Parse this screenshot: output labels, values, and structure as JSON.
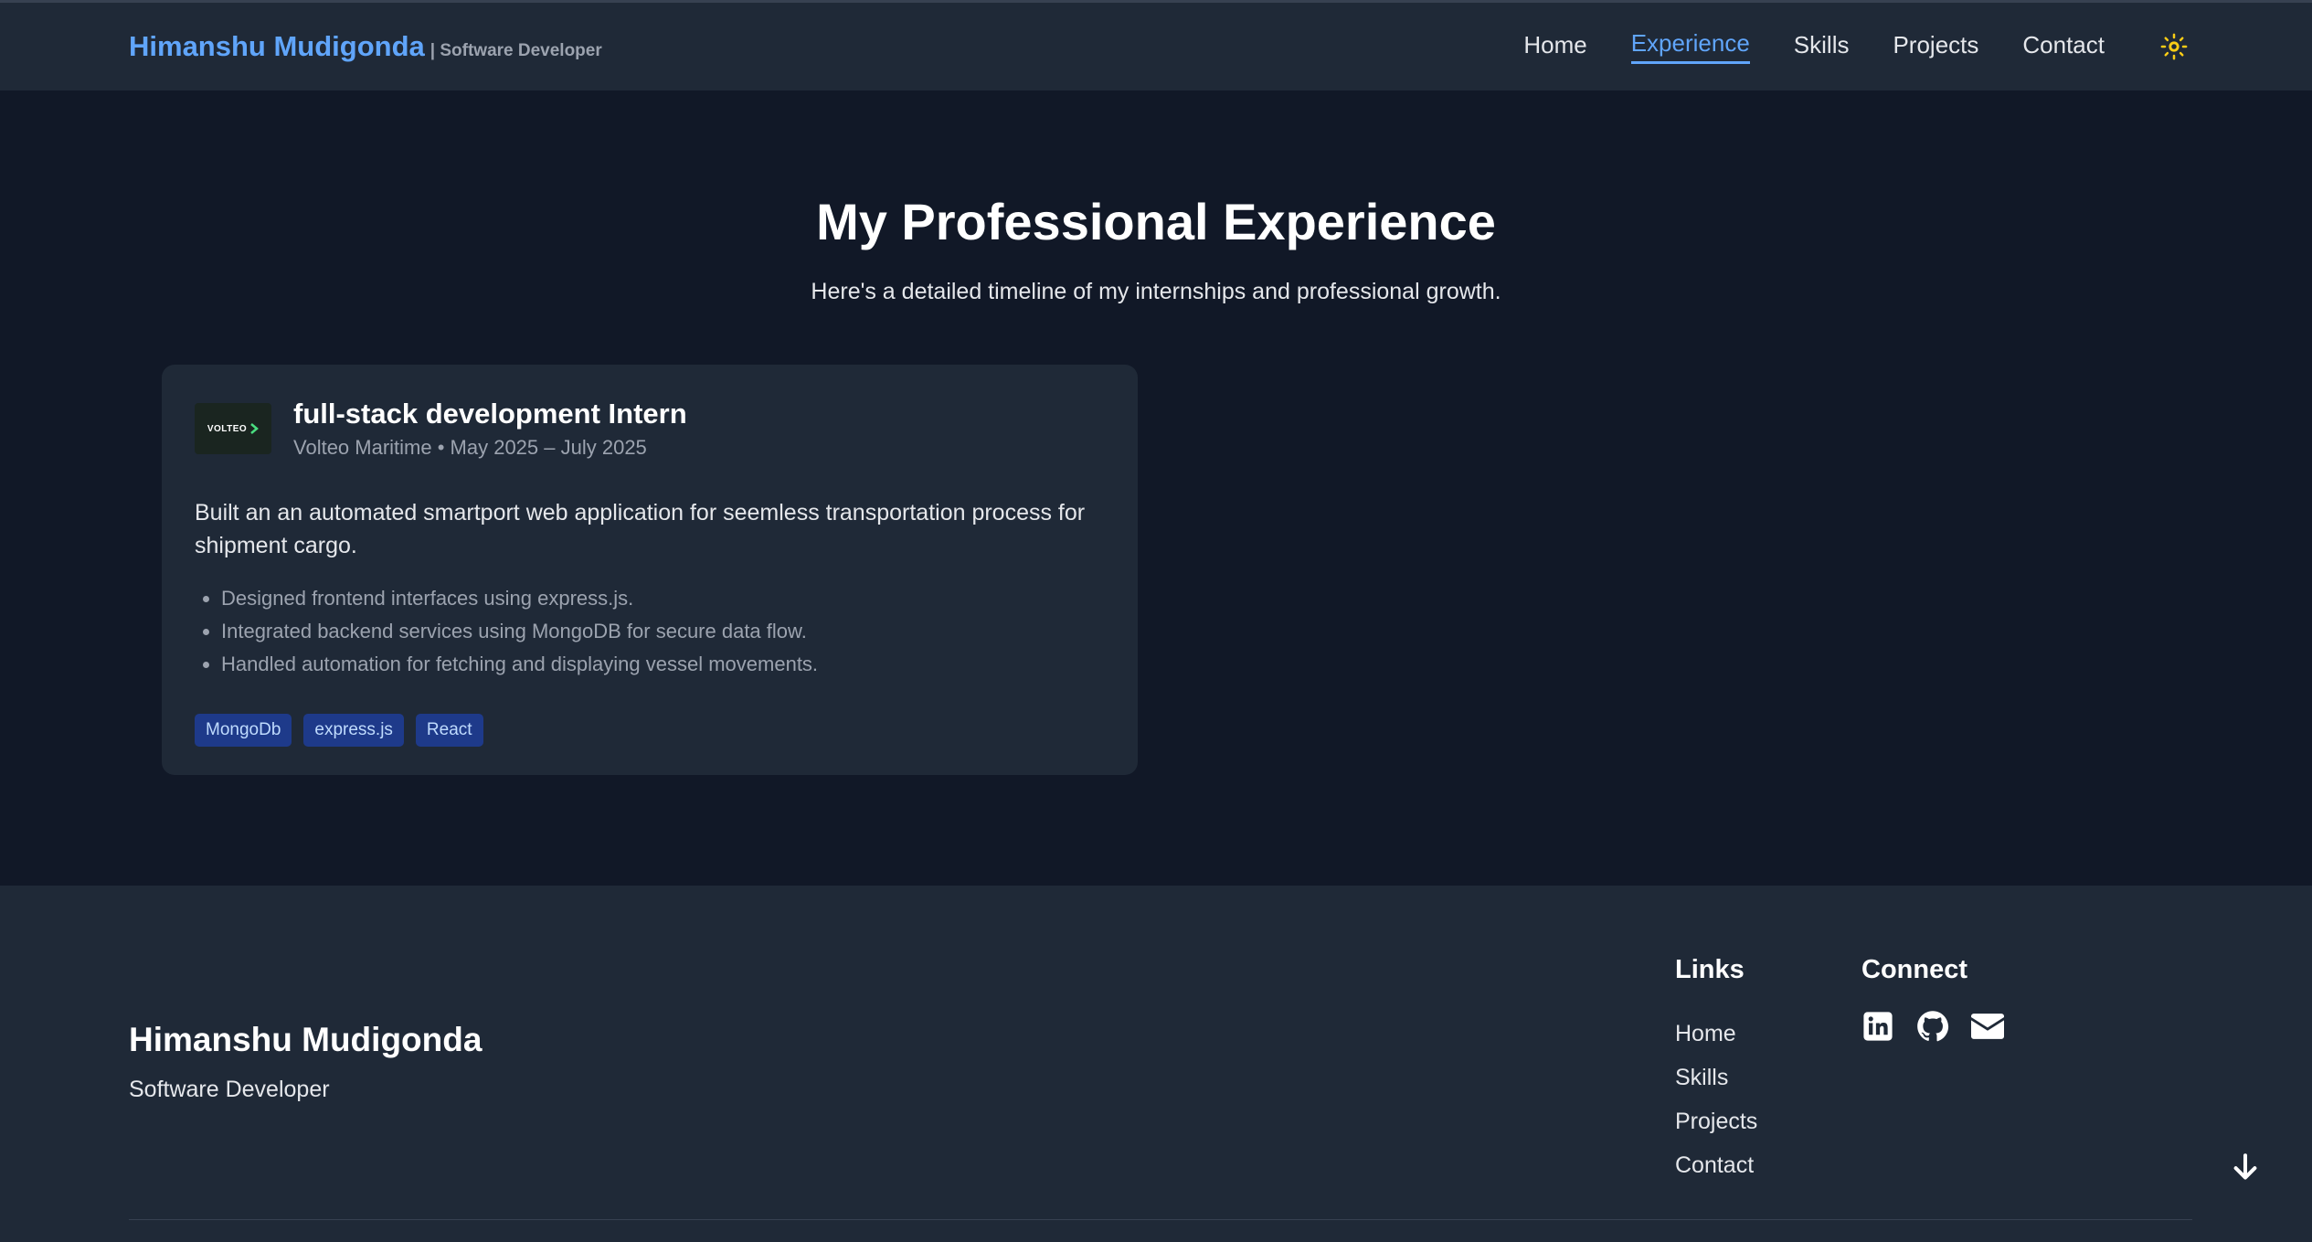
{
  "nav": {
    "brand_name": "Himanshu Mudigonda",
    "brand_role": "| Software Developer",
    "links": [
      {
        "label": "Home",
        "active": false
      },
      {
        "label": "Experience",
        "active": true
      },
      {
        "label": "Skills",
        "active": false
      },
      {
        "label": "Projects",
        "active": false
      },
      {
        "label": "Contact",
        "active": false
      }
    ],
    "theme_icon": "sun-icon"
  },
  "hero": {
    "title": "My Professional Experience",
    "subtitle": "Here's a detailed timeline of my internships and professional growth."
  },
  "experience": [
    {
      "logo_text": "VOLTEO",
      "title": "full-stack development Intern",
      "meta": "Volteo Maritime • May 2025 – July 2025",
      "description": "Built an an automated smartport web application for seemless transportation process for shipment cargo.",
      "bullets": [
        "Designed frontend interfaces using express.js.",
        "Integrated backend services using MongoDB for secure data flow.",
        "Handled automation for fetching and displaying vessel movements."
      ],
      "tags": [
        "MongoDb",
        "express.js",
        "React"
      ]
    }
  ],
  "footer": {
    "name": "Himanshu Mudigonda",
    "role": "Software Developer",
    "links_title": "Links",
    "links": [
      "Home",
      "Skills",
      "Projects",
      "Contact"
    ],
    "connect_title": "Connect",
    "social": [
      "linkedin-icon",
      "github-icon",
      "email-icon"
    ]
  },
  "colors": {
    "background": "#111827",
    "surface": "#1f2937",
    "accent": "#60a5fa",
    "tag_bg": "#1e3a8a",
    "sun": "#facc15"
  }
}
